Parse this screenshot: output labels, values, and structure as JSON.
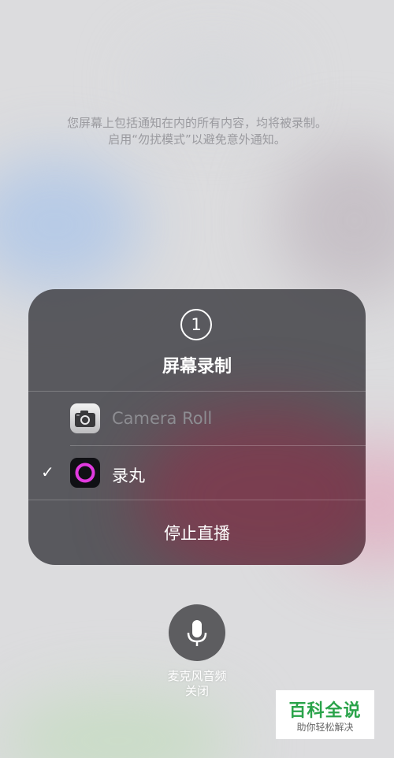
{
  "notice": {
    "line1": "您屏幕上包括通知在内的所有内容，均将被录制。",
    "line2": "启用“勿扰模式”以避免意外通知。"
  },
  "panel": {
    "badge": "1",
    "title": "屏幕录制",
    "apps": [
      {
        "label": "Camera Roll",
        "selected": false,
        "icon": "camera-icon"
      },
      {
        "label": "录丸",
        "selected": true,
        "icon": "luwan-icon"
      }
    ],
    "checkmark": "✓",
    "stop_label": "停止直播"
  },
  "mic": {
    "icon": "microphone-icon",
    "label": "麦克风音频",
    "status": "关闭"
  },
  "watermark": {
    "title": "百科全说",
    "subtitle": "助你轻松解决"
  },
  "colors": {
    "panel": "#444448",
    "accent_ring": "#e23ae0",
    "watermark_green": "#2aa34a"
  }
}
